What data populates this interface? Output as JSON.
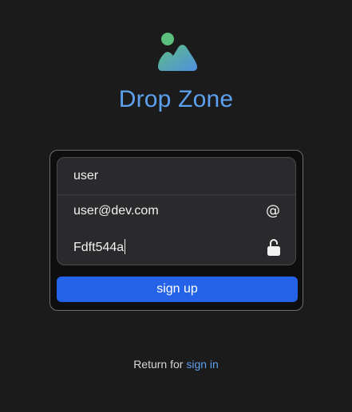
{
  "brand": {
    "title": "Drop Zone",
    "logo_icon": "image-landscape-icon",
    "title_color": "#5da0ee"
  },
  "form": {
    "username_value": "user",
    "email_value": "user@dev.com",
    "email_icon": "at-icon",
    "email_icon_glyph": "@",
    "password_value": "Fdft544a",
    "password_icon": "unlocked-lock-icon",
    "submit_label": "sign up",
    "submit_color": "#2463e8"
  },
  "footer": {
    "prompt_text": "Return for",
    "link_text": "sign in"
  }
}
